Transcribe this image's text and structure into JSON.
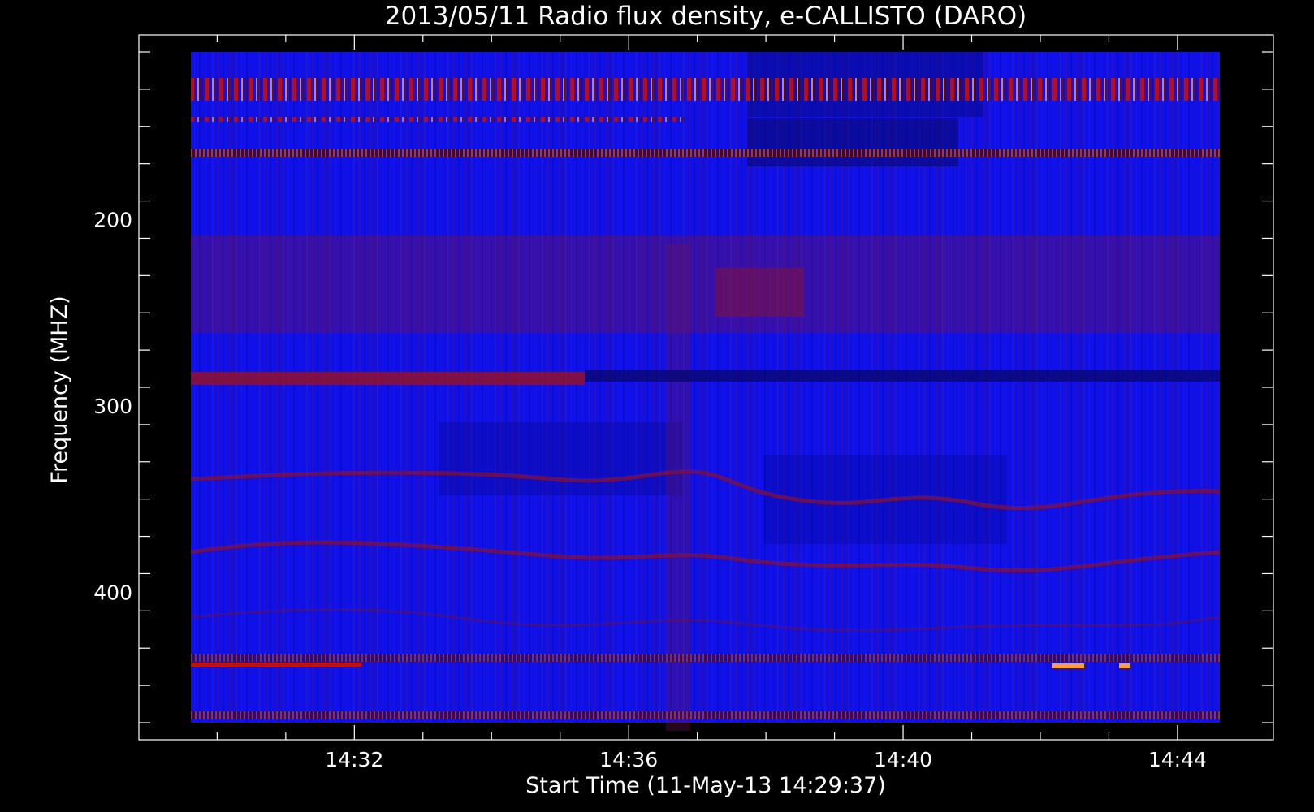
{
  "chart_data": {
    "type": "heatmap",
    "title": "2013/05/11  Radio flux density, e-CALLISTO (DARO)",
    "xlabel": "Start Time (11-May-13 14:29:37)",
    "ylabel": "Frequency (MHZ)",
    "x_ticks": [
      {
        "label": "14:32",
        "minutes": 32
      },
      {
        "label": "14:36",
        "minutes": 36
      },
      {
        "label": "14:40",
        "minutes": 40
      },
      {
        "label": "14:44",
        "minutes": 44
      }
    ],
    "y_ticks": [
      {
        "label": "200",
        "value": 200
      },
      {
        "label": "300",
        "value": 300
      },
      {
        "label": "400",
        "value": 400
      }
    ],
    "x_range": [
      "14:29:37",
      "14:44:37"
    ],
    "y_range_mhz": [
      110,
      470
    ],
    "y_axis_inverted": true,
    "colors": {
      "background": "#000000",
      "axes": "#ffffff",
      "low": "#1010e8",
      "mid": "#8a1030",
      "high": "#ffb030"
    },
    "features": [
      {
        "name": "bright interference band",
        "freq_mhz": 135
      },
      {
        "name": "interference band",
        "freq_mhz": 145
      },
      {
        "name": "interference band",
        "freq_mhz": 164
      },
      {
        "name": "broadband spike region",
        "freq_mhz_range": [
          215,
          265
        ]
      },
      {
        "name": "interference band",
        "freq_mhz": 285
      },
      {
        "name": "interference band",
        "freq_mhz": 440
      },
      {
        "name": "interference band",
        "freq_mhz": 466
      }
    ]
  }
}
